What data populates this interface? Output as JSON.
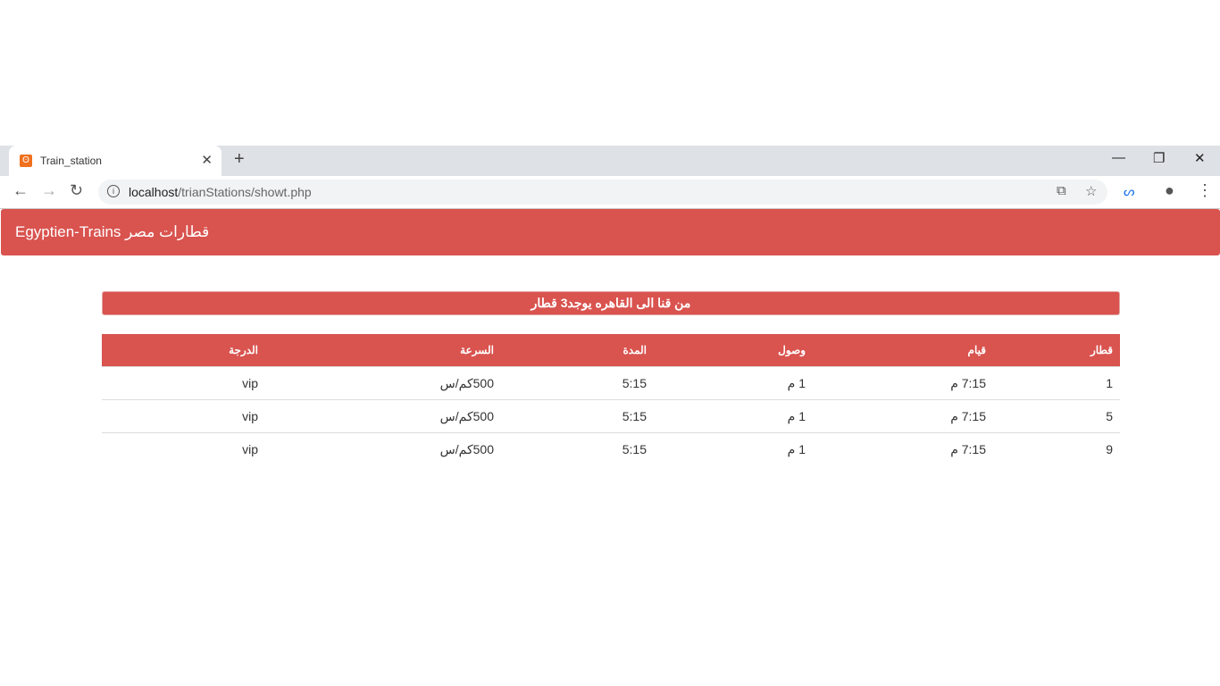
{
  "browser": {
    "tab_title": "Train_station",
    "url_host": "localhost",
    "url_path": "/trianStations/showt.php"
  },
  "navbar": {
    "brand": "Egyptien-Trains قطارات مصر"
  },
  "alert": {
    "text": "من قنا الى القاهره يوجد3 قطار"
  },
  "table": {
    "headers": [
      "قطار",
      "قيام",
      "وصول",
      "المدة",
      "السرعة",
      "الدرجة"
    ],
    "rows": [
      [
        "1",
        "7:15 م",
        "1 م",
        "5:15",
        "500كم/س",
        "vip"
      ],
      [
        "5",
        "7:15 م",
        "1 م",
        "5:15",
        "500كم/س",
        "vip"
      ],
      [
        "9",
        "7:15 م",
        "1 م",
        "5:15",
        "500كم/س",
        "vip"
      ]
    ]
  },
  "colors": {
    "accent": "#d9534f"
  }
}
